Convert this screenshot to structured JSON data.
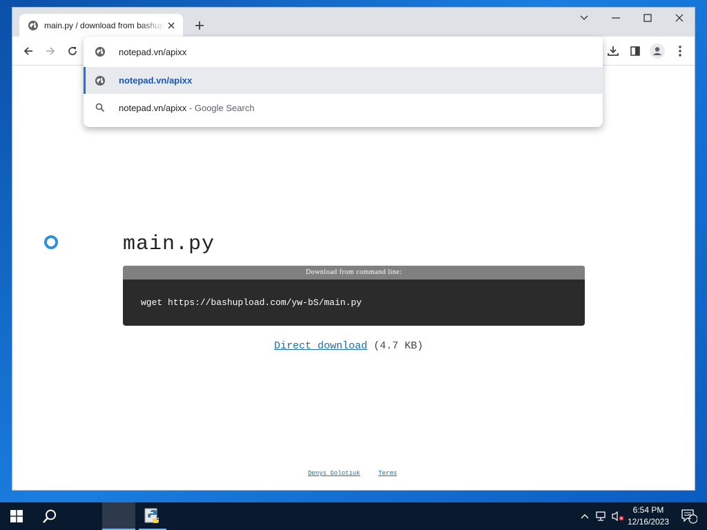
{
  "browser": {
    "tab": {
      "title": "main.py / download from bashupload"
    },
    "omnibox": {
      "input_value": "notepad.vn/apixx",
      "suggestions": [
        {
          "text": "notepad.vn/apixx",
          "suffix": ""
        },
        {
          "text": "notepad.vn/apixx",
          "suffix": " - Google Search"
        }
      ]
    }
  },
  "page": {
    "file_name": "main.py",
    "command_header": "Download from command line:",
    "command": "wget https://bashupload.com/yw-bS/main.py",
    "download_link": "Direct download",
    "file_size": "(4.7 KB)",
    "footer": {
      "author": "Denys Golotiuk",
      "terms": "Terms"
    }
  },
  "taskbar": {
    "time": "6:54 PM",
    "date": "12/16/2023",
    "notification_count": "2"
  },
  "colors": {
    "accent": "#1a73e8",
    "link": "#1b6ea8",
    "desktop": "#0b5cc0",
    "taskbar": "#0a1a2e"
  }
}
